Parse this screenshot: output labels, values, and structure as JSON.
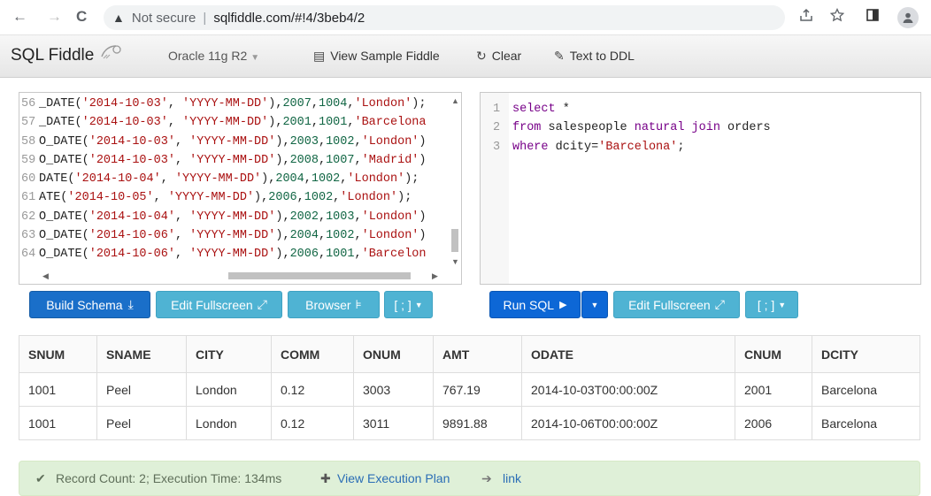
{
  "browser": {
    "back": "←",
    "forward": "→",
    "reload": "C",
    "warn_icon": "▲",
    "not_secure": "Not secure",
    "url": "sqlfiddle.com/#!4/3beb4/2"
  },
  "app": {
    "brand": "SQL Fiddle",
    "db_version": "Oracle 11g R2",
    "nav": {
      "view_sample": "View Sample Fiddle",
      "clear": "Clear",
      "text_to_ddl": "Text to DDL"
    }
  },
  "schema_panel": {
    "lines": [
      {
        "n": "56",
        "parts": [
          [
            "p",
            "_DATE("
          ],
          [
            "s",
            "'2014-10-03'"
          ],
          [
            "p",
            ", "
          ],
          [
            "s",
            "'YYYY-MM-DD'"
          ],
          [
            "p",
            "),"
          ],
          [
            "n",
            "2007"
          ],
          [
            "p",
            ","
          ],
          [
            "n",
            "1004"
          ],
          [
            "p",
            ","
          ],
          [
            "s",
            "'London'"
          ],
          [
            "p",
            ");"
          ]
        ]
      },
      {
        "n": "57",
        "parts": [
          [
            "p",
            "_DATE("
          ],
          [
            "s",
            "'2014-10-03'"
          ],
          [
            "p",
            ", "
          ],
          [
            "s",
            "'YYYY-MM-DD'"
          ],
          [
            "p",
            "),"
          ],
          [
            "n",
            "2001"
          ],
          [
            "p",
            ","
          ],
          [
            "n",
            "1001"
          ],
          [
            "p",
            ","
          ],
          [
            "s",
            "'Barcelona"
          ]
        ]
      },
      {
        "n": "58",
        "parts": [
          [
            "p",
            "O_DATE("
          ],
          [
            "s",
            "'2014-10-03'"
          ],
          [
            "p",
            ", "
          ],
          [
            "s",
            "'YYYY-MM-DD'"
          ],
          [
            "p",
            "),"
          ],
          [
            "n",
            "2003"
          ],
          [
            "p",
            ","
          ],
          [
            "n",
            "1002"
          ],
          [
            "p",
            ","
          ],
          [
            "s",
            "'London'"
          ],
          [
            "p",
            ")"
          ]
        ]
      },
      {
        "n": "59",
        "parts": [
          [
            "p",
            "O_DATE("
          ],
          [
            "s",
            "'2014-10-03'"
          ],
          [
            "p",
            ", "
          ],
          [
            "s",
            "'YYYY-MM-DD'"
          ],
          [
            "p",
            "),"
          ],
          [
            "n",
            "2008"
          ],
          [
            "p",
            ","
          ],
          [
            "n",
            "1007"
          ],
          [
            "p",
            ","
          ],
          [
            "s",
            "'Madrid'"
          ],
          [
            "p",
            ")"
          ]
        ]
      },
      {
        "n": "60",
        "parts": [
          [
            "p",
            "DATE("
          ],
          [
            "s",
            "'2014-10-04'"
          ],
          [
            "p",
            ", "
          ],
          [
            "s",
            "'YYYY-MM-DD'"
          ],
          [
            "p",
            "),"
          ],
          [
            "n",
            "2004"
          ],
          [
            "p",
            ","
          ],
          [
            "n",
            "1002"
          ],
          [
            "p",
            ","
          ],
          [
            "s",
            "'London'"
          ],
          [
            "p",
            ");"
          ]
        ]
      },
      {
        "n": "61",
        "parts": [
          [
            "p",
            "ATE("
          ],
          [
            "s",
            "'2014-10-05'"
          ],
          [
            "p",
            ", "
          ],
          [
            "s",
            "'YYYY-MM-DD'"
          ],
          [
            "p",
            "),"
          ],
          [
            "n",
            "2006"
          ],
          [
            "p",
            ","
          ],
          [
            "n",
            "1002"
          ],
          [
            "p",
            ","
          ],
          [
            "s",
            "'London'"
          ],
          [
            "p",
            ");"
          ]
        ]
      },
      {
        "n": "62",
        "parts": [
          [
            "p",
            "O_DATE("
          ],
          [
            "s",
            "'2014-10-04'"
          ],
          [
            "p",
            ", "
          ],
          [
            "s",
            "'YYYY-MM-DD'"
          ],
          [
            "p",
            "),"
          ],
          [
            "n",
            "2002"
          ],
          [
            "p",
            ","
          ],
          [
            "n",
            "1003"
          ],
          [
            "p",
            ","
          ],
          [
            "s",
            "'London'"
          ],
          [
            "p",
            ")"
          ]
        ]
      },
      {
        "n": "63",
        "parts": [
          [
            "p",
            "O_DATE("
          ],
          [
            "s",
            "'2014-10-06'"
          ],
          [
            "p",
            ", "
          ],
          [
            "s",
            "'YYYY-MM-DD'"
          ],
          [
            "p",
            "),"
          ],
          [
            "n",
            "2004"
          ],
          [
            "p",
            ","
          ],
          [
            "n",
            "1002"
          ],
          [
            "p",
            ","
          ],
          [
            "s",
            "'London'"
          ],
          [
            "p",
            ")"
          ]
        ]
      },
      {
        "n": "64",
        "parts": [
          [
            "p",
            "O_DATE("
          ],
          [
            "s",
            "'2014-10-06'"
          ],
          [
            "p",
            ", "
          ],
          [
            "s",
            "'YYYY-MM-DD'"
          ],
          [
            "p",
            "),"
          ],
          [
            "n",
            "2006"
          ],
          [
            "p",
            ","
          ],
          [
            "n",
            "1001"
          ],
          [
            "p",
            ","
          ],
          [
            "s",
            "'Barcelon"
          ]
        ]
      }
    ],
    "buttons": {
      "build_schema": "Build Schema",
      "edit_fullscreen": "Edit Fullscreen",
      "browser": "Browser",
      "terminator": "[ ; ]"
    }
  },
  "query_panel": {
    "lines": [
      {
        "n": "1",
        "parts": [
          [
            "k",
            "select"
          ],
          [
            "p",
            " *"
          ]
        ]
      },
      {
        "n": "2",
        "parts": [
          [
            "k",
            "from"
          ],
          [
            "p",
            " salespeople "
          ],
          [
            "k",
            "natural join"
          ],
          [
            "p",
            " orders"
          ]
        ]
      },
      {
        "n": "3",
        "parts": [
          [
            "k",
            "where"
          ],
          [
            "p",
            " dcity="
          ],
          [
            "s",
            "'Barcelona'"
          ],
          [
            "p",
            ";"
          ]
        ]
      }
    ],
    "buttons": {
      "run_sql": "Run SQL",
      "edit_fullscreen": "Edit Fullscreen",
      "terminator": "[ ; ]"
    }
  },
  "results": {
    "columns": [
      "SNUM",
      "SNAME",
      "CITY",
      "COMM",
      "ONUM",
      "AMT",
      "ODATE",
      "CNUM",
      "DCITY"
    ],
    "rows": [
      [
        "1001",
        "Peel",
        "London",
        "0.12",
        "3003",
        "767.19",
        "2014-10-03T00:00:00Z",
        "2001",
        "Barcelona"
      ],
      [
        "1001",
        "Peel",
        "London",
        "0.12",
        "3011",
        "9891.88",
        "2014-10-06T00:00:00Z",
        "2006",
        "Barcelona"
      ]
    ]
  },
  "status": {
    "record_text": "Record Count: 2; Execution Time: 134ms",
    "view_plan": "View Execution Plan",
    "link": "link"
  }
}
